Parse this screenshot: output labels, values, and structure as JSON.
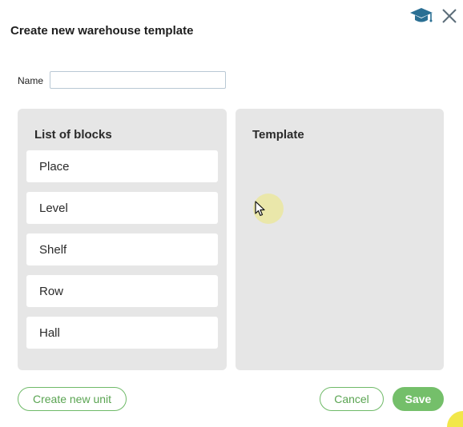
{
  "dialog": {
    "title": "Create new warehouse template",
    "help_icon": "graduation-cap-icon",
    "close_icon": "close-icon"
  },
  "name_field": {
    "label": "Name",
    "value": "",
    "placeholder": ""
  },
  "blocks_panel": {
    "heading": "List of blocks",
    "items": [
      {
        "label": "Place"
      },
      {
        "label": "Level"
      },
      {
        "label": "Shelf"
      },
      {
        "label": "Row"
      },
      {
        "label": "Hall"
      }
    ]
  },
  "template_panel": {
    "heading": "Template"
  },
  "footer": {
    "create_unit_label": "Create new unit",
    "cancel_label": "Cancel",
    "save_label": "Save"
  },
  "colors": {
    "accent": "#74bf6a",
    "help_icon": "#2a6f93",
    "panel_bg": "#e6e6e6"
  }
}
